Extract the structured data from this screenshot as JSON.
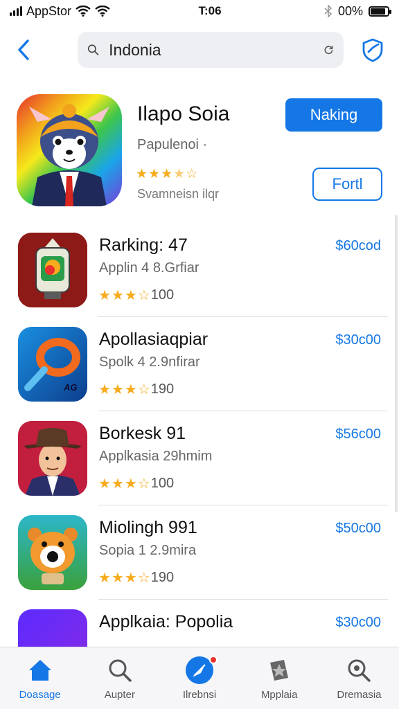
{
  "status_bar": {
    "carrier": "AppStor",
    "time": "T:06",
    "battery_text": "00%",
    "battery_level": 0.88,
    "icons": [
      "signal-icon",
      "wifi-icon",
      "bluetooth-icon",
      "battery-icon"
    ]
  },
  "nav": {
    "back_icon": "chevron-left-icon",
    "search": {
      "value": "Indonia",
      "icons": [
        "search-icon",
        "refresh-icon"
      ]
    },
    "shield_icon": "shield-check-icon"
  },
  "featured": {
    "title": "Ilapo Soia",
    "subtitle": "Papulenoi ·",
    "rating": 3.5,
    "meta": "Svamneisn ilqr",
    "primary_button": "Naking",
    "secondary_button": "Fortl"
  },
  "apps": [
    {
      "title": "Rarking: 47",
      "subtitle": "Applin 4 8.Grfiar",
      "rating": 3,
      "count": "100",
      "price": "$60cod"
    },
    {
      "title": "Apollasiaqpiar",
      "subtitle": "Spolk 4 2.9nfirar",
      "rating": 3,
      "count": "190",
      "price": "$30c00"
    },
    {
      "title": "Borkesk 91",
      "subtitle": "Applkasia 29hmim",
      "rating": 3,
      "count": "100",
      "price": "$56c00"
    },
    {
      "title": "Miolingh 991",
      "subtitle": "Sopia 1 2.9mira",
      "rating": 3,
      "count": "190",
      "price": "$50c00"
    },
    {
      "title": "Applkaia: Popolia",
      "subtitle": "",
      "rating": 0,
      "count": "",
      "price": "$30c00"
    }
  ],
  "tabs": [
    {
      "label": "Doasage",
      "icon": "home-icon",
      "active": true
    },
    {
      "label": "Aupter",
      "icon": "search-icon",
      "active": false
    },
    {
      "label": "Ilrebnsi",
      "icon": "compass-icon",
      "active": false,
      "badge": true
    },
    {
      "label": "Mpplaia",
      "icon": "star-tag-icon",
      "active": false
    },
    {
      "label": "Dremasia",
      "icon": "magnifier-icon",
      "active": false
    }
  ],
  "colors": {
    "accent": "#1577e6",
    "star": "#f6ac1e",
    "badge": "#e8312d"
  }
}
